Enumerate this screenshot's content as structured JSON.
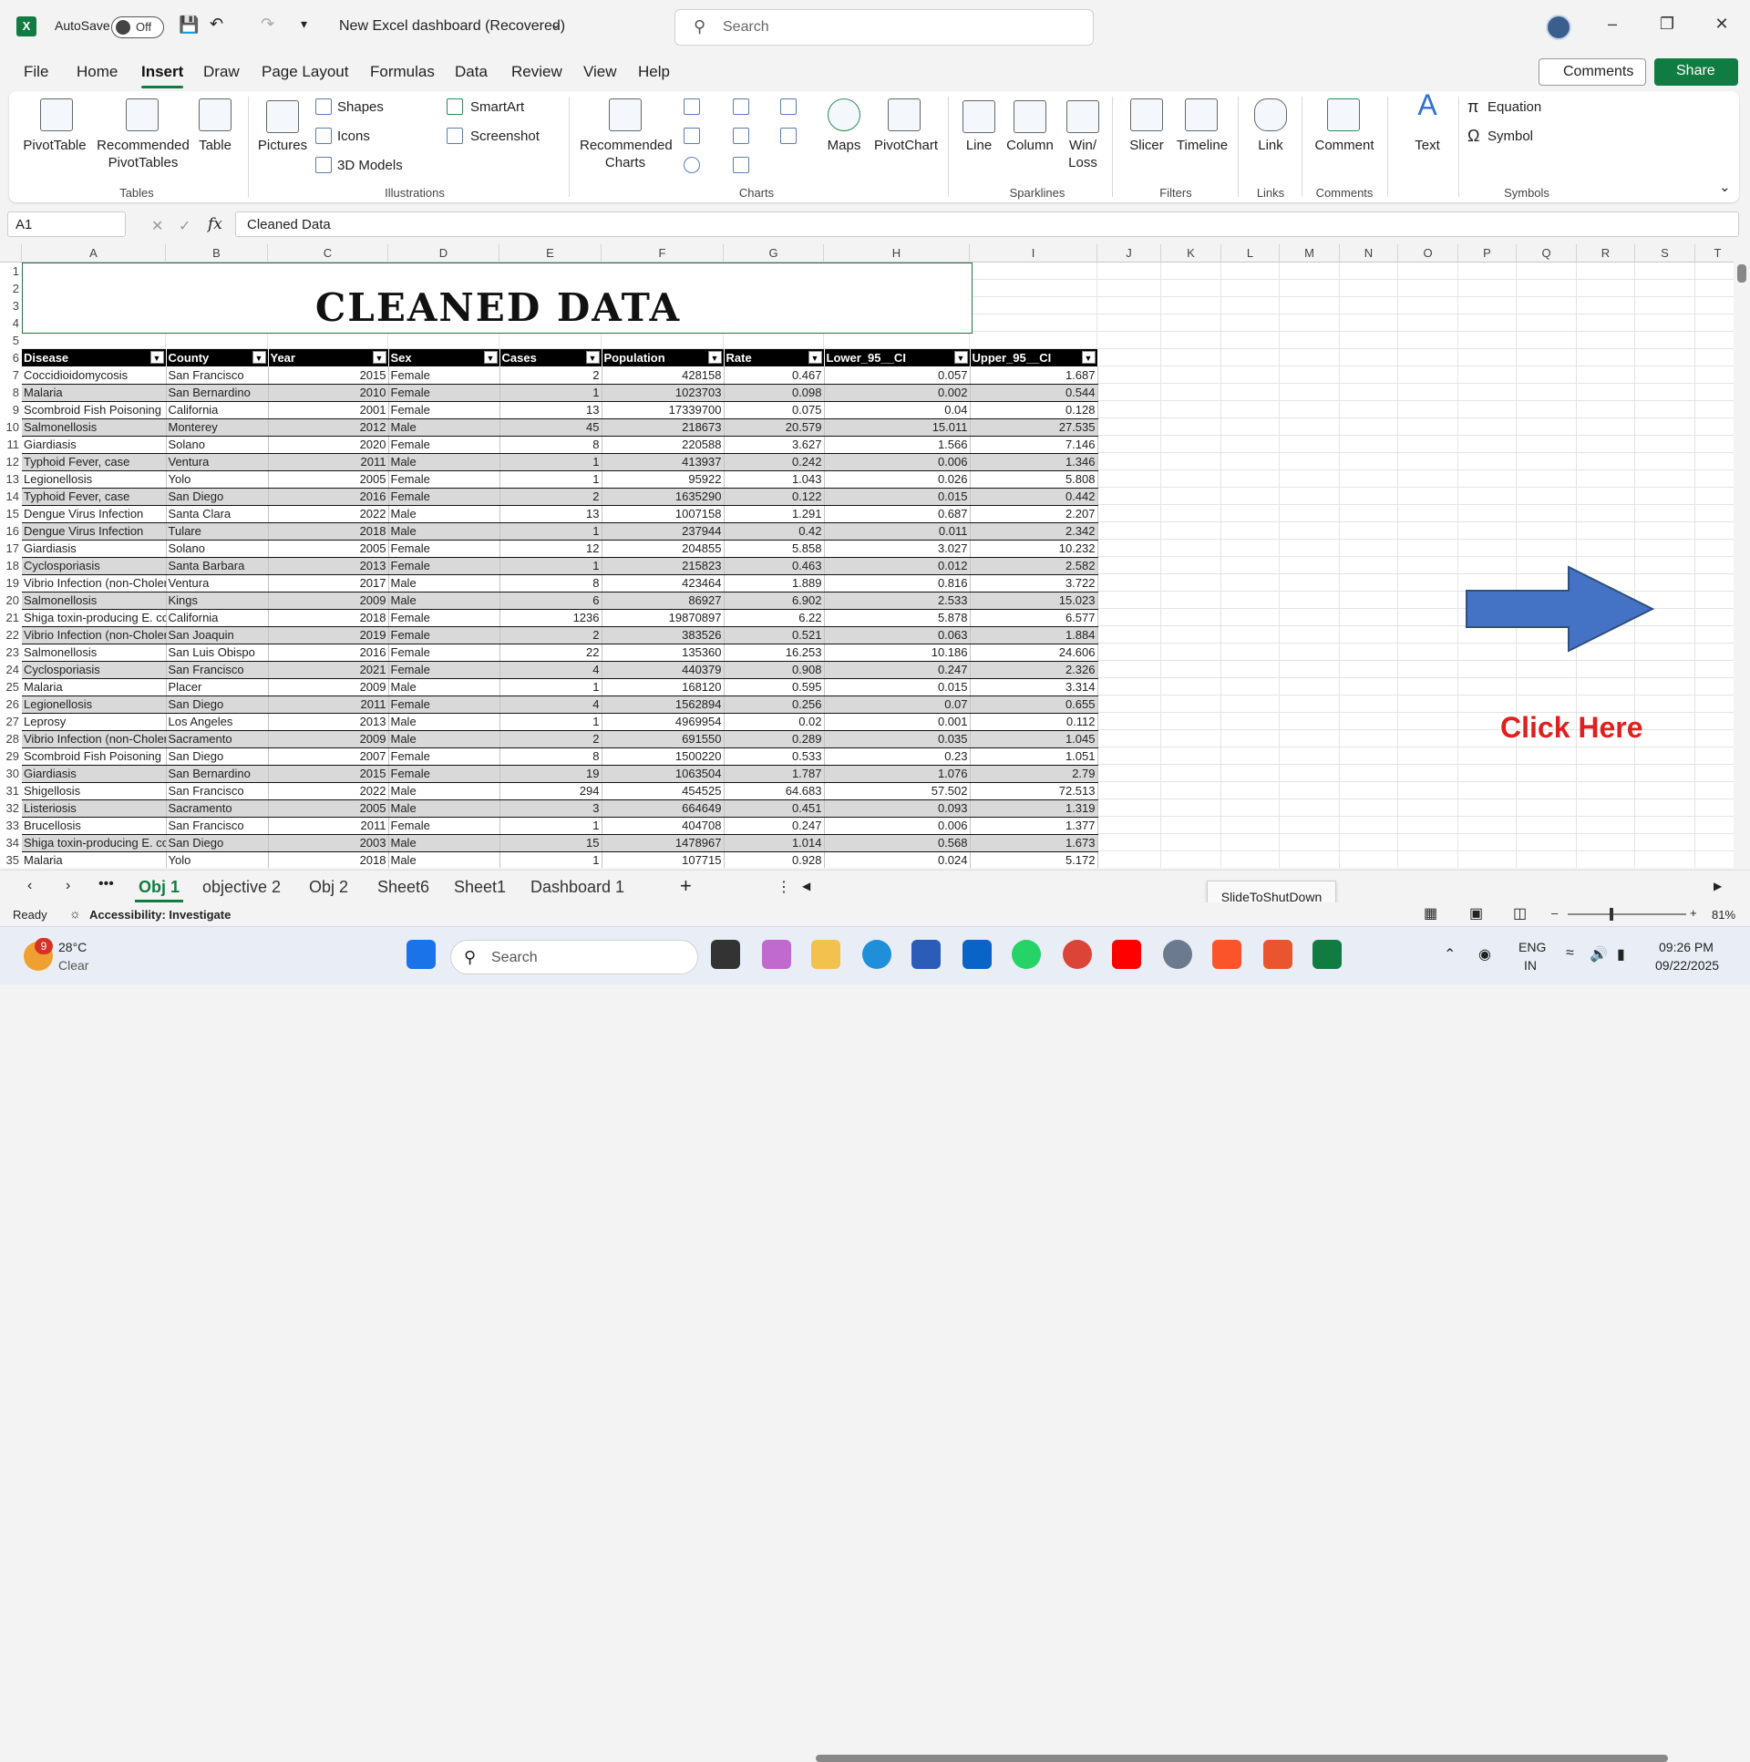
{
  "titlebar": {
    "autosave_label": "AutoSave",
    "autosave_state": "Off",
    "doc_title": "New Excel dashboard (Recovered)",
    "search_placeholder": "Search"
  },
  "menu": [
    "File",
    "Home",
    "Insert",
    "Draw",
    "Page Layout",
    "Formulas",
    "Data",
    "Review",
    "View",
    "Help"
  ],
  "menu_active": "Insert",
  "actions": {
    "comments": "Comments",
    "share": "Share"
  },
  "ribbon": {
    "tables": {
      "group": "Tables",
      "pivottable": "PivotTable",
      "recommended_pivot": "Recommended PivotTables",
      "table": "Table"
    },
    "illustrations": {
      "group": "Illustrations",
      "pictures": "Pictures",
      "shapes": "Shapes",
      "icons": "Icons",
      "models": "3D Models",
      "smartart": "SmartArt",
      "screenshot": "Screenshot"
    },
    "charts": {
      "group": "Charts",
      "recommended": "Recommended Charts",
      "maps": "Maps",
      "pivotchart": "PivotChart"
    },
    "sparklines": {
      "group": "Sparklines",
      "line": "Line",
      "column": "Column",
      "winloss": "Win/ Loss"
    },
    "filters": {
      "group": "Filters",
      "slicer": "Slicer",
      "timeline": "Timeline"
    },
    "links": {
      "group": "Links",
      "link": "Link"
    },
    "comments": {
      "group": "Comments",
      "comment": "Comment"
    },
    "text": {
      "text": "Text"
    },
    "symbols": {
      "group": "Symbols",
      "equation": "Equation",
      "symbol": "Symbol"
    }
  },
  "formula_bar": {
    "cell": "A1",
    "content": "Cleaned Data"
  },
  "columns": [
    "A",
    "B",
    "C",
    "D",
    "E",
    "F",
    "G",
    "H",
    "I",
    "J",
    "K",
    "L",
    "M",
    "N",
    "O",
    "P",
    "Q",
    "R",
    "S",
    "T"
  ],
  "title": "CLEANED DATA",
  "table_headers": [
    "Disease",
    "County",
    "Year",
    "Sex",
    "Cases",
    "Population",
    "Rate",
    "Lower_95__CI",
    "Upper_95__CI"
  ],
  "rows": [
    [
      "Coccidioidomycosis",
      "San Francisco",
      "2015",
      "Female",
      "2",
      "428158",
      "0.467",
      "0.057",
      "1.687"
    ],
    [
      "Malaria",
      "San Bernardino",
      "2010",
      "Female",
      "1",
      "1023703",
      "0.098",
      "0.002",
      "0.544"
    ],
    [
      "Scombroid Fish Poisoning",
      "California",
      "2001",
      "Female",
      "13",
      "17339700",
      "0.075",
      "0.04",
      "0.128"
    ],
    [
      "Salmonellosis",
      "Monterey",
      "2012",
      "Male",
      "45",
      "218673",
      "20.579",
      "15.011",
      "27.535"
    ],
    [
      "Giardiasis",
      "Solano",
      "2020",
      "Female",
      "8",
      "220588",
      "3.627",
      "1.566",
      "7.146"
    ],
    [
      "Typhoid Fever, case",
      "Ventura",
      "2011",
      "Male",
      "1",
      "413937",
      "0.242",
      "0.006",
      "1.346"
    ],
    [
      "Legionellosis",
      "Yolo",
      "2005",
      "Female",
      "1",
      "95922",
      "1.043",
      "0.026",
      "5.808"
    ],
    [
      "Typhoid Fever, case",
      "San Diego",
      "2016",
      "Female",
      "2",
      "1635290",
      "0.122",
      "0.015",
      "0.442"
    ],
    [
      "Dengue Virus Infection",
      "Santa Clara",
      "2022",
      "Male",
      "13",
      "1007158",
      "1.291",
      "0.687",
      "2.207"
    ],
    [
      "Dengue Virus Infection",
      "Tulare",
      "2018",
      "Male",
      "1",
      "237944",
      "0.42",
      "0.011",
      "2.342"
    ],
    [
      "Giardiasis",
      "Solano",
      "2005",
      "Female",
      "12",
      "204855",
      "5.858",
      "3.027",
      "10.232"
    ],
    [
      "Cyclosporiasis",
      "Santa Barbara",
      "2013",
      "Female",
      "1",
      "215823",
      "0.463",
      "0.012",
      "2.582"
    ],
    [
      "Vibrio Infection (non-Cholera)",
      "Ventura",
      "2017",
      "Male",
      "8",
      "423464",
      "1.889",
      "0.816",
      "3.722"
    ],
    [
      "Salmonellosis",
      "Kings",
      "2009",
      "Male",
      "6",
      "86927",
      "6.902",
      "2.533",
      "15.023"
    ],
    [
      "Shiga toxin-producing E. coli",
      "California",
      "2018",
      "Female",
      "1236",
      "19870897",
      "6.22",
      "5.878",
      "6.577"
    ],
    [
      "Vibrio Infection (non-Cholera)",
      "San Joaquin",
      "2019",
      "Female",
      "2",
      "383526",
      "0.521",
      "0.063",
      "1.884"
    ],
    [
      "Salmonellosis",
      "San Luis Obispo",
      "2016",
      "Female",
      "22",
      "135360",
      "16.253",
      "10.186",
      "24.606"
    ],
    [
      "Cyclosporiasis",
      "San Francisco",
      "2021",
      "Female",
      "4",
      "440379",
      "0.908",
      "0.247",
      "2.326"
    ],
    [
      "Malaria",
      "Placer",
      "2009",
      "Male",
      "1",
      "168120",
      "0.595",
      "0.015",
      "3.314"
    ],
    [
      "Legionellosis",
      "San Diego",
      "2011",
      "Female",
      "4",
      "1562894",
      "0.256",
      "0.07",
      "0.655"
    ],
    [
      "Leprosy",
      "Los Angeles",
      "2013",
      "Male",
      "1",
      "4969954",
      "0.02",
      "0.001",
      "0.112"
    ],
    [
      "Vibrio Infection (non-Cholera)",
      "Sacramento",
      "2009",
      "Male",
      "2",
      "691550",
      "0.289",
      "0.035",
      "1.045"
    ],
    [
      "Scombroid Fish Poisoning",
      "San Diego",
      "2007",
      "Female",
      "8",
      "1500220",
      "0.533",
      "0.23",
      "1.051"
    ],
    [
      "Giardiasis",
      "San Bernardino",
      "2015",
      "Female",
      "19",
      "1063504",
      "1.787",
      "1.076",
      "2.79"
    ],
    [
      "Shigellosis",
      "San Francisco",
      "2022",
      "Male",
      "294",
      "454525",
      "64.683",
      "57.502",
      "72.513"
    ],
    [
      "Listeriosis",
      "Sacramento",
      "2005",
      "Male",
      "3",
      "664649",
      "0.451",
      "0.093",
      "1.319"
    ],
    [
      "Brucellosis",
      "San Francisco",
      "2011",
      "Female",
      "1",
      "404708",
      "0.247",
      "0.006",
      "1.377"
    ],
    [
      "Shiga toxin-producing E. coli",
      "San Diego",
      "2003",
      "Male",
      "15",
      "1478967",
      "1.014",
      "0.568",
      "1.673"
    ],
    [
      "Malaria",
      "Yolo",
      "2018",
      "Male",
      "1",
      "107715",
      "0.928",
      "0.024",
      "5.172"
    ]
  ],
  "click_here": "Click Here",
  "sheet_tabs": [
    "Obj 1",
    "objective 2",
    "Obj 2",
    "Sheet6",
    "Sheet1",
    "Dashboard 1"
  ],
  "active_sheet": "Obj 1",
  "tooltip": "SlideToShutDown",
  "status": {
    "ready": "Ready",
    "accessibility": "Accessibility: Investigate",
    "zoom": "81%"
  },
  "taskbar": {
    "weather_temp": "28°C",
    "weather_desc": "Clear",
    "weather_badge": "9",
    "search": "Search",
    "lang1": "ENG",
    "lang2": "IN",
    "time": "09:26 PM",
    "date": "09/22/2025"
  },
  "colors": {
    "excel_green": "#107c41",
    "arrow_blue": "#4472c4",
    "click_red": "#e01f1f"
  }
}
